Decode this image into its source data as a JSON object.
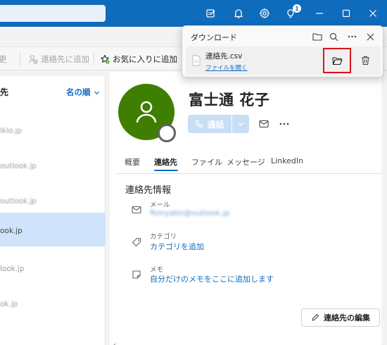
{
  "ribbon": {
    "cut_label": "連絡先",
    "cut_prefix": "更",
    "add_contact_label": "連絡先に追加",
    "add_favorite_label": "お気に入りに追加"
  },
  "list": {
    "header": "先",
    "sort_label": "名の順",
    "rows": [
      "lkio.jp",
      "outlook.jp",
      "outlook.jp",
      "ook.jp",
      "look.jp",
      "ok.jp"
    ]
  },
  "contact": {
    "name": "富士通 花子",
    "call_label": "通話",
    "tabs": [
      "概要",
      "連絡先",
      "ファイル",
      "メッセージ",
      "LinkedIn"
    ],
    "active_tab": "連絡先",
    "section_title": "連絡先情報",
    "email_label": "メール",
    "email_value": "fkmyabn@outlook.jp",
    "category_label": "カテゴリ",
    "category_value": "カテゴリを追加",
    "memo_label": "メモ",
    "memo_value": "自分だけのメモをここに追加します",
    "edit_button_label": "連絡先の編集",
    "avatar_color": "#3e7e00"
  },
  "download": {
    "title": "ダウンロード",
    "file_name": "連絡先.csv",
    "open_file_label": "ファイルを開く",
    "highlight_color": "#e0121b"
  },
  "titlebar": {
    "badge_count": "1",
    "accent_color": "#0f6cbd"
  }
}
